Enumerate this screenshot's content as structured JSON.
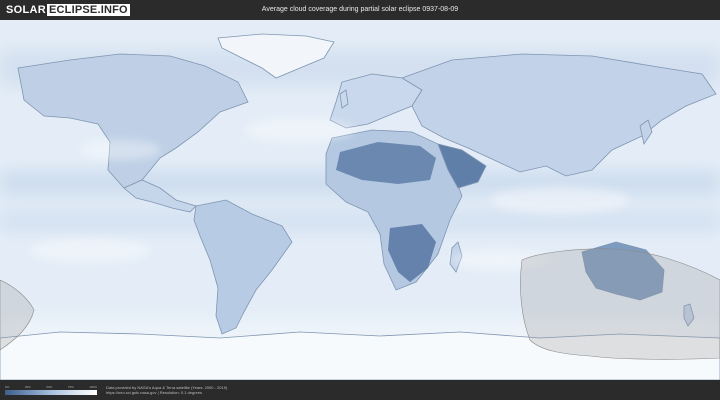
{
  "header": {
    "logo_part1": "SOLAR",
    "logo_part2": "ECLIPSE.INFO",
    "title": "Average cloud coverage during partial solar eclipse 0937-08-09"
  },
  "legend": {
    "ticks": [
      "0%",
      "25%",
      "50%",
      "75%",
      "100%"
    ],
    "colors": [
      "#3f5f8a",
      "#6f8fb8",
      "#a8bfdb",
      "#d8e3f0",
      "#ffffff"
    ]
  },
  "footer": {
    "credit_line1": "Data provided by NASA's Aqua & Terra satellite (Years: 2000 - 2019)",
    "credit_line2": "https://neo.sci.gsfc.nasa.gov | Resolution: 0.1 degrees"
  },
  "map": {
    "projection": "equirectangular",
    "ocean_color": "#e4edf7",
    "land_outline_color": "#7f95b2",
    "eclipse_shadow_color": "#9a9a9a"
  }
}
